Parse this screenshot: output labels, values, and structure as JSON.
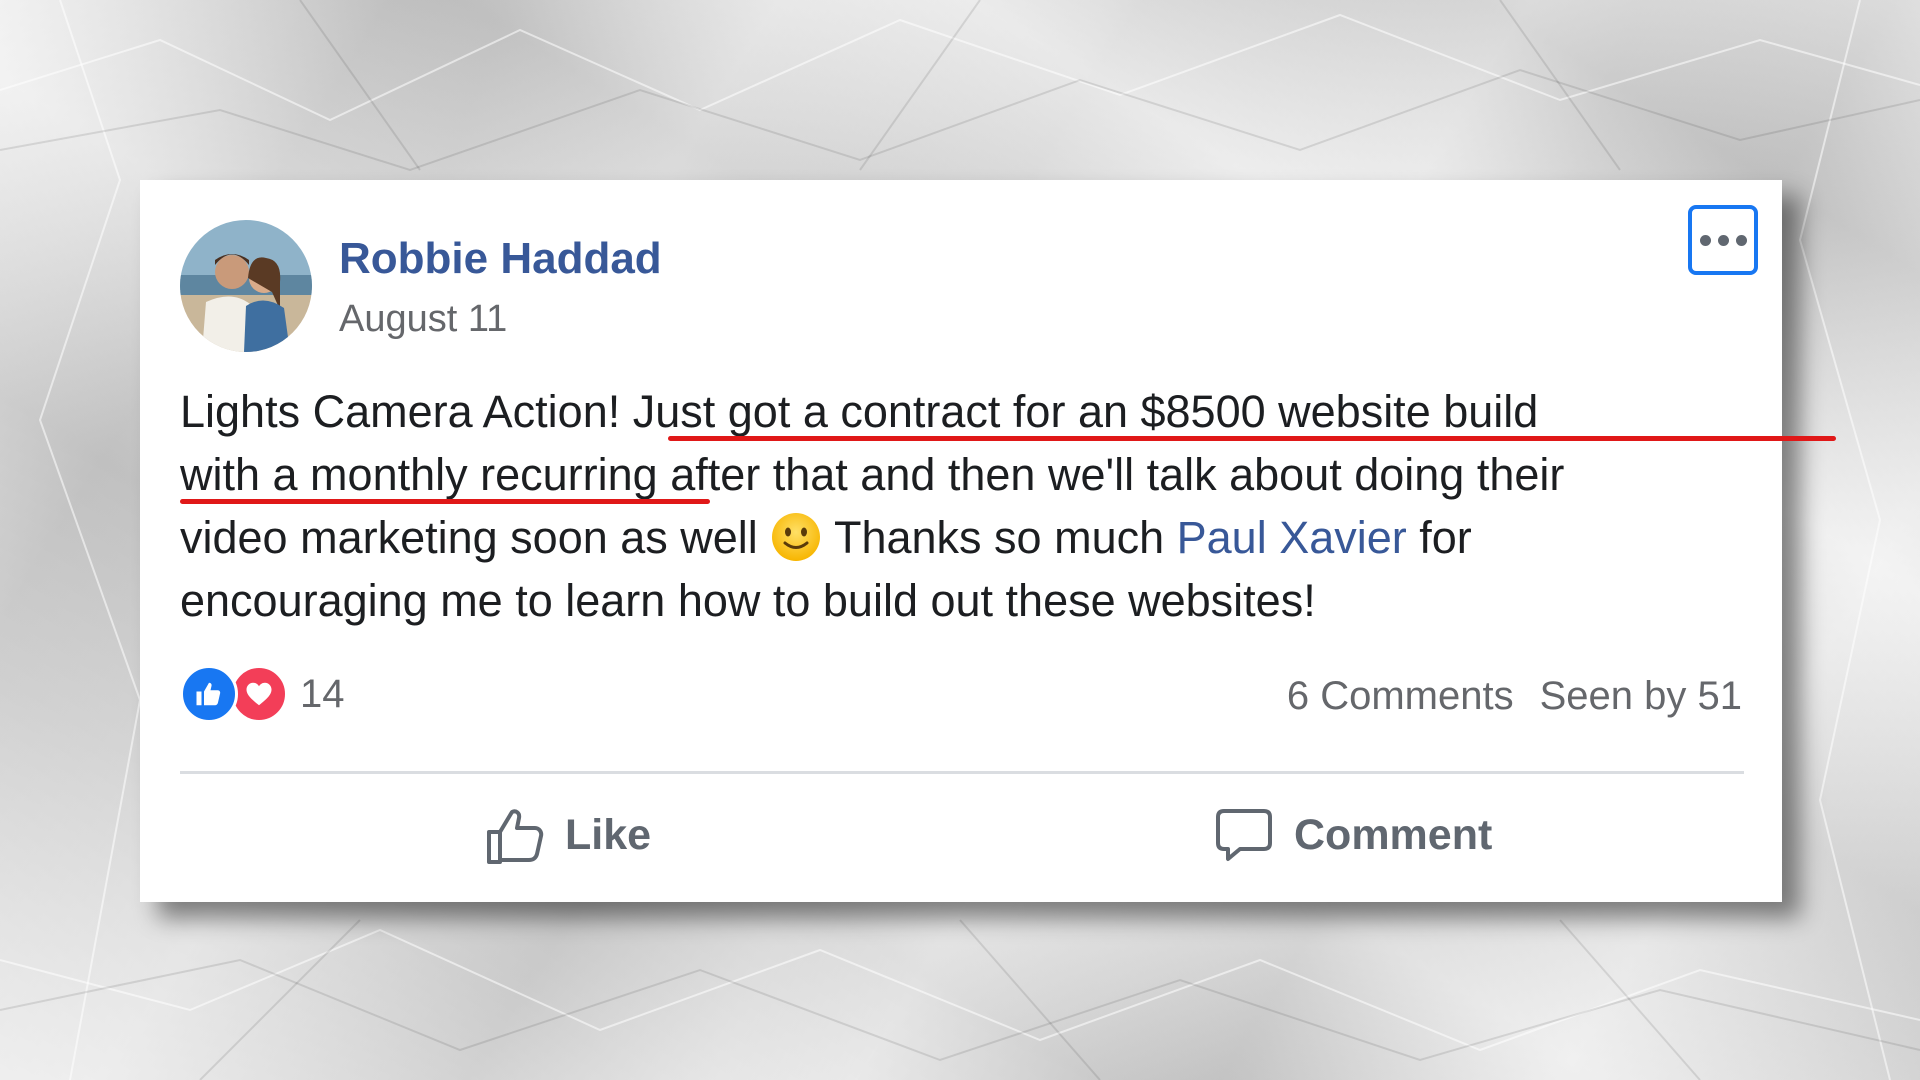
{
  "post": {
    "author": "Robbie Haddad",
    "date": "August 11",
    "avatar_icon": "couple-photo-avatar",
    "more_icon": "more-options-icon",
    "body": {
      "line1_a": "Lights Camera Action! ",
      "line1_b": "Just got a contract for an $8500 website build",
      "line2_a": "with a monthly recurring",
      "line2_b": " after that and then we'll talk about doing their",
      "line3_a": "video marketing soon as well ",
      "line3_emoji": "slightly-smiling-face-emoji",
      "line3_b": " Thanks so much ",
      "mention": "Paul Xavier",
      "line3_c": " for",
      "line4": "encouraging me to learn how to build out these websites!"
    },
    "highlight_color": "#e01818"
  },
  "reactions": {
    "icons": [
      "like-reaction-icon",
      "love-reaction-icon"
    ],
    "count": "14"
  },
  "stats": {
    "comments": "6 Comments",
    "seen_by": "Seen by 51"
  },
  "actions": {
    "like_label": "Like",
    "comment_label": "Comment"
  },
  "colors": {
    "name_link": "#385898",
    "like_blue": "#1877f2",
    "love_red": "#f33e58",
    "text_secondary": "#65676b"
  }
}
